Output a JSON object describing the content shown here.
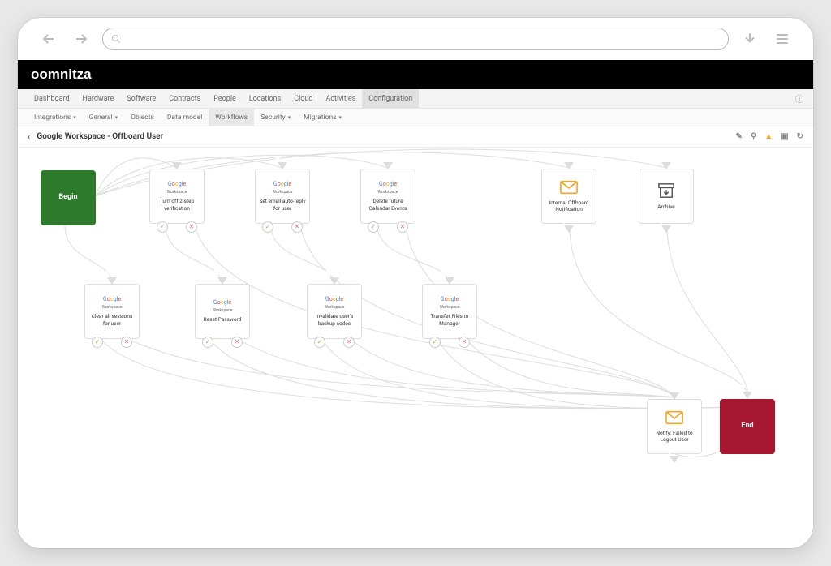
{
  "logo_text": "oomnitza",
  "top_tabs": [
    "Dashboard",
    "Hardware",
    "Software",
    "Contracts",
    "People",
    "Locations",
    "Cloud",
    "Activities",
    "Configuration"
  ],
  "top_tab_active": "Configuration",
  "sub_tabs": [
    {
      "label": "Integrations",
      "caret": true
    },
    {
      "label": "General",
      "caret": true
    },
    {
      "label": "Objects",
      "caret": false
    },
    {
      "label": "Data model",
      "caret": false
    },
    {
      "label": "Workflows",
      "caret": false,
      "active": true
    },
    {
      "label": "Security",
      "caret": true
    },
    {
      "label": "Migrations",
      "caret": true
    }
  ],
  "page_title": "Google Workspace - Offboard User",
  "nodes": {
    "begin": {
      "label": "Begin"
    },
    "end": {
      "label": "End"
    },
    "turn_off_2step": {
      "title": "Turn off 2-step verification",
      "vendor": "Google",
      "vendor_sub": "Workspace"
    },
    "set_autoreply": {
      "title": "Set email auto-reply for user",
      "vendor": "Google",
      "vendor_sub": "Workspace"
    },
    "delete_calendar": {
      "title": "Delete future Calendar Events",
      "vendor": "Google",
      "vendor_sub": "Workspace"
    },
    "internal_offboard": {
      "title": "Internal Offboard Notification"
    },
    "archive": {
      "title": "Archive"
    },
    "clear_sessions": {
      "title": "Clear all sessions for user",
      "vendor": "Google",
      "vendor_sub": "Workspace"
    },
    "reset_password": {
      "title": "Reset Password",
      "vendor": "Google",
      "vendor_sub": "Workspace"
    },
    "invalidate_backup": {
      "title": "Invalidate user's backup codes",
      "vendor": "Google",
      "vendor_sub": "Workspace"
    },
    "transfer_files": {
      "title": "Transfer Files to Manager",
      "vendor": "Google",
      "vendor_sub": "Workspace"
    },
    "notify_failed": {
      "title": "Notify: Failed to Logout User"
    }
  }
}
